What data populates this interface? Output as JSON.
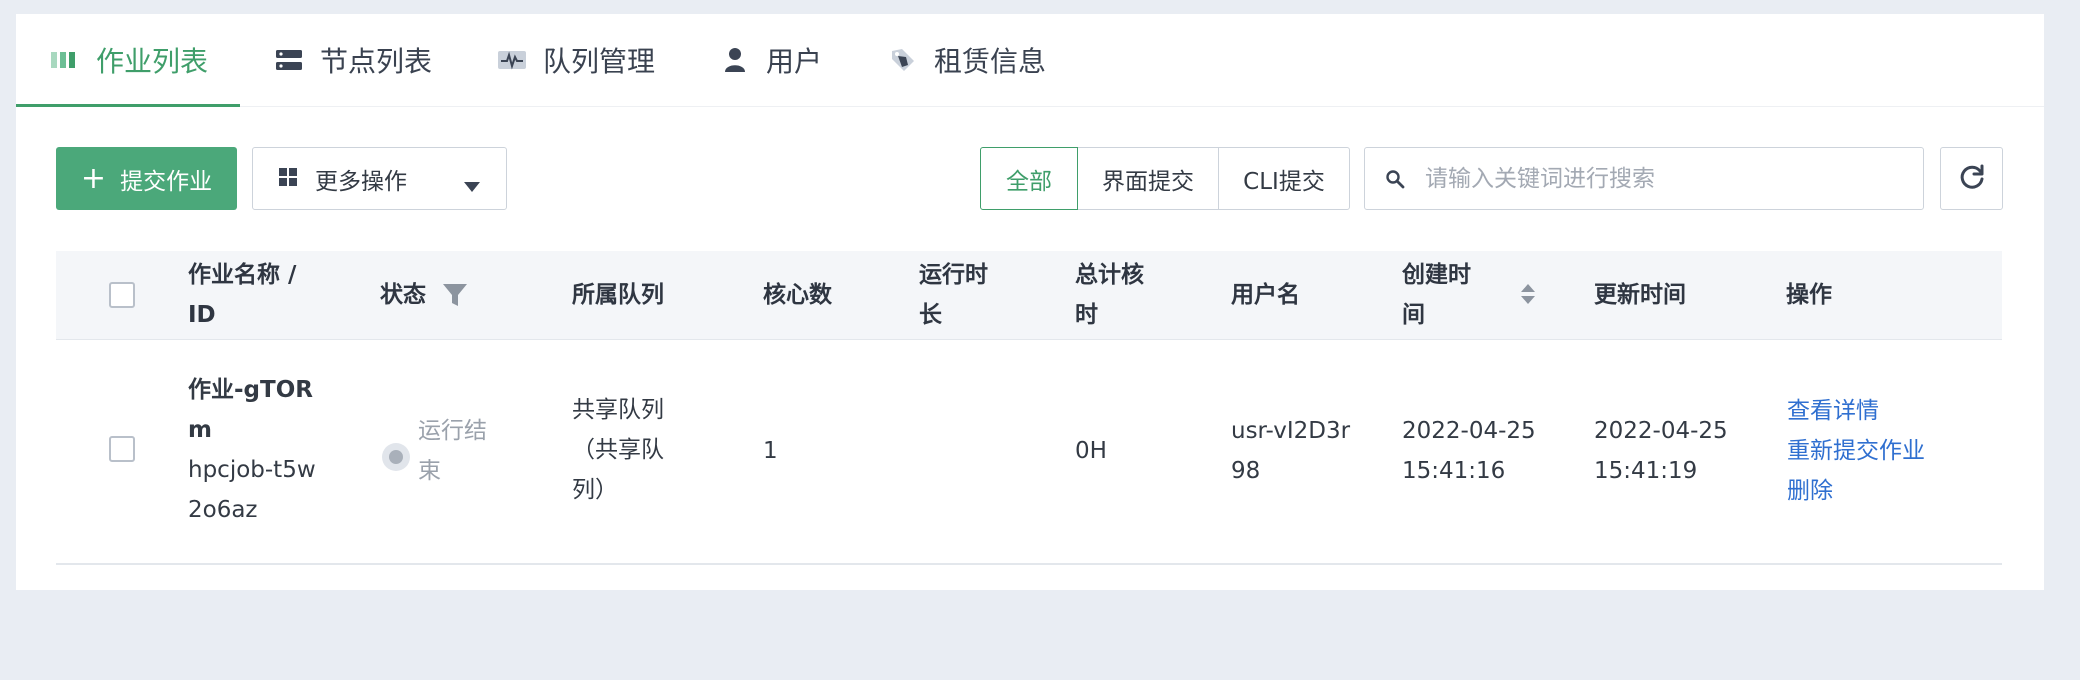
{
  "tabs": [
    {
      "label": "作业列表",
      "icon": "bar-columns-icon",
      "active": true
    },
    {
      "label": "节点列表",
      "icon": "server-icon",
      "active": false
    },
    {
      "label": "队列管理",
      "icon": "activity-monitor-icon",
      "active": false
    },
    {
      "label": "用户",
      "icon": "user-icon",
      "active": false
    },
    {
      "label": "租赁信息",
      "icon": "tag-icon",
      "active": false
    }
  ],
  "toolbar": {
    "submit_label": "提交作业",
    "more_label": "更多操作",
    "filters": [
      {
        "label": "全部",
        "active": true
      },
      {
        "label": "界面提交",
        "active": false
      },
      {
        "label": "CLI提交",
        "active": false
      }
    ],
    "search_placeholder": "请输入关键词进行搜索",
    "search_value": ""
  },
  "table": {
    "columns": {
      "name": "作业名称 / ID",
      "status": "状态",
      "queue": "所属队列",
      "cores": "核心数",
      "runtime": "运行时长",
      "core_hours": "总计核时",
      "user": "用户名",
      "created": "创建时间",
      "updated": "更新时间",
      "actions": "操作"
    },
    "rows": [
      {
        "name": "作业-gTORm",
        "id": "hpcjob-t5w2o6az",
        "status": "运行结束",
        "queue": "共享队列（共享队列）",
        "cores": "1",
        "runtime": "",
        "core_hours": "0H",
        "user": "usr-vI2D3r98",
        "created": "2022-04-25 15:41:16",
        "updated": "2022-04-25 15:41:19",
        "actions": [
          "查看详情",
          "重新提交作业",
          "删除"
        ]
      }
    ]
  },
  "colors": {
    "accent": "#4ba87a",
    "accent_text": "#3f9e6a",
    "link": "#2f6fd0",
    "background": "#e9edf3"
  }
}
